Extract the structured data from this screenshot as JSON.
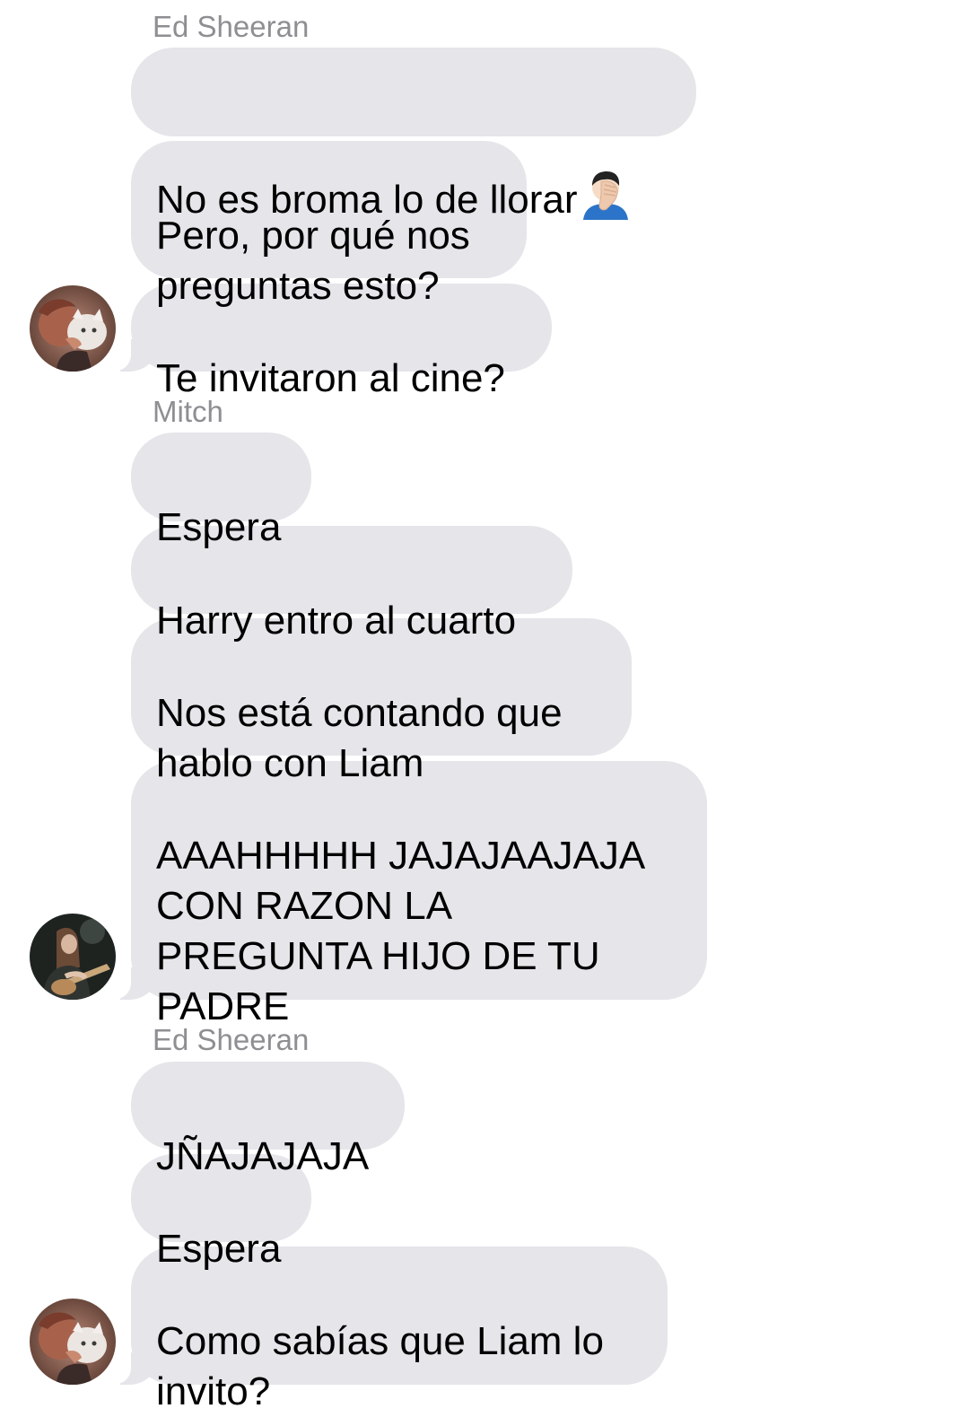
{
  "groups": [
    {
      "sender": "Ed Sheeran",
      "messages": [
        "No es broma lo de llorar",
        "Pero, por qué nos\npreguntas esto?",
        "Te invitaron al cine?"
      ],
      "emoji_icon": "person-facepalming-icon"
    },
    {
      "sender": "Mitch",
      "messages": [
        "Espera",
        "Harry entro al cuarto",
        "Nos está contando que\nhablo con Liam",
        "AAAHHHHH JAJAJAAJAJA\nCON RAZON LA\nPREGUNTA HIJO DE TU\nPADRE"
      ]
    },
    {
      "sender": "Ed Sheeran",
      "messages": [
        "JÑAJAJAJA",
        "Espera",
        "Como sabías que Liam lo\ninvito?"
      ]
    }
  ],
  "colors": {
    "bubble": "#e5e5ea",
    "sender_label": "#8e8e93",
    "text": "#000000"
  }
}
